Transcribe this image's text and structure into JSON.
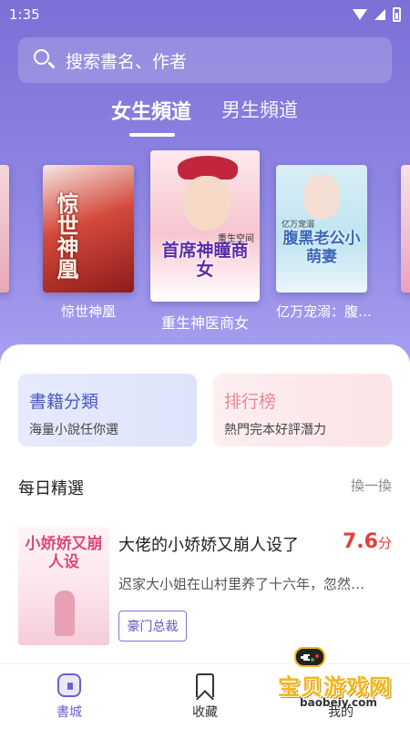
{
  "status_bar": {
    "time": "1:35"
  },
  "search": {
    "placeholder": "搜索書名、作者"
  },
  "tabs": [
    {
      "label": "女生頻道",
      "active": true
    },
    {
      "label": "男生頻道",
      "active": false
    }
  ],
  "carousel": {
    "books": [
      {
        "title": "惊世神凰",
        "cover_text": "惊世神凰"
      },
      {
        "title": "重生神医商女",
        "cover_text": "首席神瞳商女",
        "cover_subtext": "重生空间"
      },
      {
        "title": "亿万宠溺：腹…",
        "cover_text": "腹黑老公小萌妻",
        "cover_subtext": "亿万宠溺"
      }
    ]
  },
  "cards": [
    {
      "title": "書籍分類",
      "subtitle": "海量小說任你選"
    },
    {
      "title": "排行榜",
      "subtitle": "熱門完本好評潛力"
    }
  ],
  "daily": {
    "title": "每日精選",
    "refresh": "換一換",
    "book": {
      "title": "大佬的小娇娇又崩人设了",
      "score": "7.6",
      "score_unit": "分",
      "description": "迟家大小姐在山村里养了十六年，忽然…",
      "tag": "豪门总裁",
      "cover_text": "小娇娇又崩人设"
    }
  },
  "bottom_nav": [
    {
      "label": "書城",
      "icon": "home-icon",
      "active": true
    },
    {
      "label": "收藏",
      "icon": "bookmark-icon",
      "active": false
    },
    {
      "label": "我的",
      "icon": "profile-icon",
      "active": false
    }
  ],
  "watermark": {
    "text": "宝贝游戏网",
    "url": "baobeiy.com"
  },
  "colors": {
    "accent": "#6a5fd0",
    "hero_top": "#7a70d6",
    "score": "#e83b3b",
    "card_left": "#e3e7fb",
    "card_right": "#fbe7ea"
  }
}
